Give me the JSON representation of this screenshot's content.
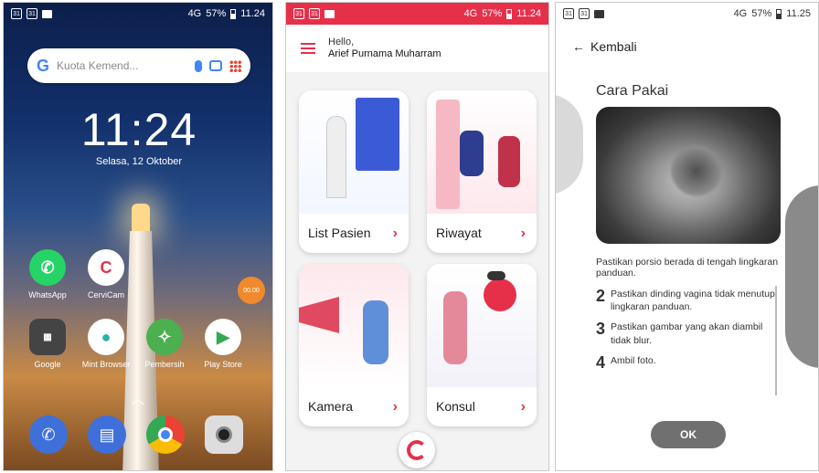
{
  "status_bar": {
    "s1": {
      "time": "11.24",
      "battery": "57%",
      "net": "4G"
    },
    "s2": {
      "time": "11.24",
      "battery": "57%",
      "net": "4G"
    },
    "s3": {
      "time": "11.25",
      "battery": "57%",
      "net": "4G"
    }
  },
  "home": {
    "search_placeholder": "Kuota Kemend...",
    "clock": "11:24",
    "date": "Selasa, 12 Oktober",
    "float_badge": "00.00",
    "apps": [
      {
        "label": "WhatsApp",
        "icon": "whatsapp-icon"
      },
      {
        "label": "CerviCam",
        "icon": "cervicam-icon"
      },
      {
        "label": "Google",
        "icon": "google-folder-icon"
      },
      {
        "label": "Mint Browser",
        "icon": "mint-browser-icon"
      },
      {
        "label": "Pembersih",
        "icon": "cleaner-icon"
      },
      {
        "label": "Play Store",
        "icon": "play-store-icon"
      }
    ],
    "dock": [
      {
        "icon": "phone-icon"
      },
      {
        "icon": "messages-icon"
      },
      {
        "icon": "chrome-icon"
      },
      {
        "icon": "camera-icon"
      }
    ]
  },
  "menu": {
    "greeting": "Hello,",
    "user_name": "Arief Purnama Muharram",
    "cards": [
      {
        "label": "List Pasien"
      },
      {
        "label": "Riwayat"
      },
      {
        "label": "Kamera"
      },
      {
        "label": "Konsul"
      }
    ],
    "accent": "#e6304a"
  },
  "guide": {
    "back_label": "Kembali",
    "title": "Cara Pakai",
    "fragment": "Pastikan porsio berada di tengah lingkaran panduan.",
    "steps": [
      {
        "num": "2",
        "text": "Pastikan dinding vagina tidak menutupi lingkaran panduan."
      },
      {
        "num": "3",
        "text": "Pastikan gambar yang akan diambil tidak blur."
      },
      {
        "num": "4",
        "text": "Ambil foto."
      }
    ],
    "ok_label": "OK"
  }
}
